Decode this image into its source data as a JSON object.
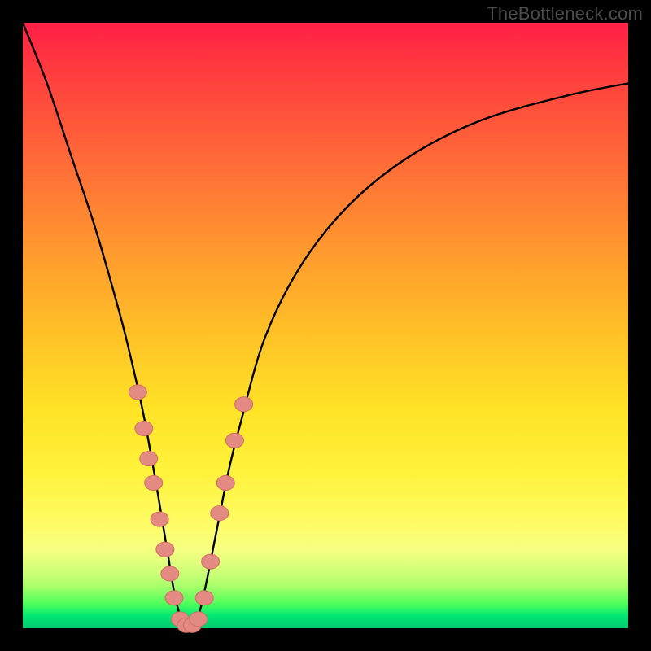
{
  "watermark": "TheBottleneck.com",
  "colors": {
    "curve_stroke": "#000000",
    "marker_fill": "#e38b82",
    "marker_stroke": "#d06f66",
    "frame_bg": "#000000"
  },
  "chart_data": {
    "type": "line",
    "title": "",
    "xlabel": "",
    "ylabel": "",
    "xlim": [
      0,
      100
    ],
    "ylim": [
      0,
      100
    ],
    "grid": false,
    "legend": false,
    "series": [
      {
        "name": "bottleneck-curve",
        "x": [
          0,
          4,
          8,
          12,
          16,
          18,
          20,
          22,
          23,
          24,
          25,
          26,
          27,
          28,
          29,
          30,
          32,
          34,
          36,
          40,
          46,
          54,
          64,
          76,
          90,
          100
        ],
        "y": [
          100,
          90,
          78,
          66,
          52,
          44,
          35,
          24,
          18,
          12,
          6,
          2,
          0,
          0,
          2,
          6,
          16,
          26,
          34,
          48,
          60,
          70,
          78,
          84,
          88,
          90
        ]
      }
    ],
    "markers": {
      "name": "highlighted-points",
      "comment": "salmon beads on the curve near the trough",
      "points": [
        {
          "x": 19.0,
          "y": 39
        },
        {
          "x": 20.0,
          "y": 33
        },
        {
          "x": 20.8,
          "y": 28
        },
        {
          "x": 21.6,
          "y": 24
        },
        {
          "x": 22.6,
          "y": 18
        },
        {
          "x": 23.5,
          "y": 13
        },
        {
          "x": 24.3,
          "y": 9
        },
        {
          "x": 25.0,
          "y": 5
        },
        {
          "x": 26.0,
          "y": 1.5
        },
        {
          "x": 27.0,
          "y": 0.5
        },
        {
          "x": 28.0,
          "y": 0.5
        },
        {
          "x": 29.0,
          "y": 1.5
        },
        {
          "x": 30.0,
          "y": 5
        },
        {
          "x": 31.0,
          "y": 11
        },
        {
          "x": 32.5,
          "y": 19
        },
        {
          "x": 33.5,
          "y": 24
        },
        {
          "x": 35.0,
          "y": 31
        },
        {
          "x": 36.5,
          "y": 37
        }
      ]
    }
  }
}
